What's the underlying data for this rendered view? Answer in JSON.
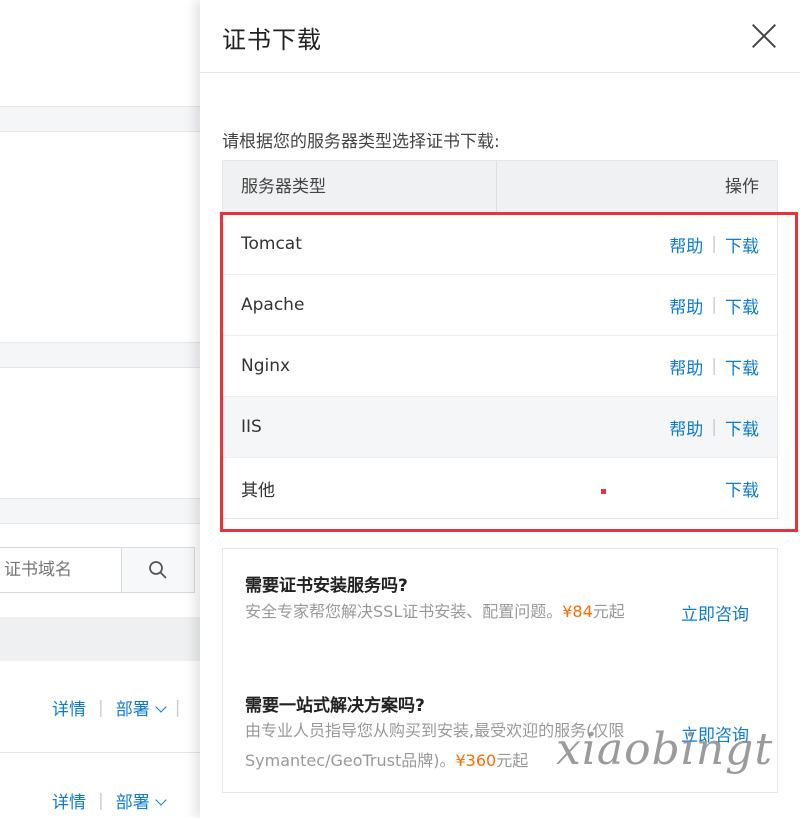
{
  "background": {
    "search_placeholder": "证书域名",
    "row_actions": [
      {
        "details": "详情",
        "deploy": "部署"
      },
      {
        "details": "详情",
        "deploy": "部署"
      }
    ]
  },
  "drawer": {
    "title": "证书下载",
    "intro": "请根据您的服务器类型选择证书下载:",
    "table": {
      "col_server": "服务器类型",
      "col_action": "操作",
      "rows": [
        {
          "name": "Tomcat",
          "help": "帮助",
          "download": "下载"
        },
        {
          "name": "Apache",
          "help": "帮助",
          "download": "下载"
        },
        {
          "name": "Nginx",
          "help": "帮助",
          "download": "下载"
        },
        {
          "name": "IIS",
          "help": "帮助",
          "download": "下载"
        },
        {
          "name": "其他",
          "help": "",
          "download": "下载"
        }
      ]
    },
    "services": [
      {
        "question": "需要证书安装服务吗?",
        "desc_before": "安全专家帮您解决SSL证书安装、配置问题。",
        "price": "¥84",
        "desc_after": "元起",
        "link": "立即咨询"
      },
      {
        "question": "需要一站式解决方案吗?",
        "desc_before": "由专业人员指导您从购买到安装,最受欢迎的服务(仅限Symantec/GeoTrust品牌)。",
        "price": "¥360",
        "desc_after": "元起",
        "link": "立即咨询"
      }
    ]
  },
  "watermark": "xiaobingt",
  "colors": {
    "link": "#0d7ad4",
    "highlight": "#e8323c",
    "price": "#ff6a00"
  }
}
